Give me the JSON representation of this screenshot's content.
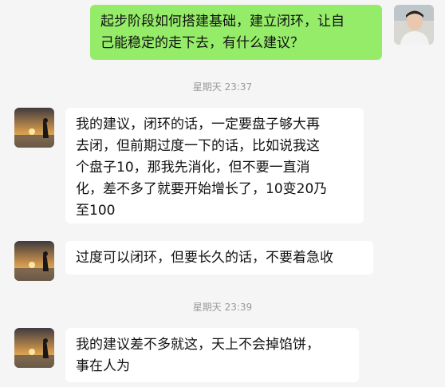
{
  "messages": [
    {
      "direction": "out",
      "lines": [
        "起步阶段如何搭建基础，建立闭环，让自",
        "己能稳定的走下去，有什么建议？"
      ]
    },
    {
      "type": "timestamp",
      "text": "星期天 23:37"
    },
    {
      "direction": "in",
      "lines": [
        "我的建议，闭环的话，一定要盘子够大再",
        "去闭，但前期过度一下的话，比如说我这",
        "个盘子10，那我先消化，但不要一直消",
        "化，差不多了就要开始增长了，10变20乃",
        "至100"
      ]
    },
    {
      "direction": "in",
      "lines": [
        "过度可以闭环，但要长久的话，不要着急收"
      ]
    },
    {
      "type": "timestamp",
      "text": "星期天 23:39"
    },
    {
      "direction": "in",
      "lines": [
        "我的建议差不多就这，天上不会掉馅饼，",
        "事在人为"
      ]
    }
  ],
  "colors": {
    "background": "#f5f5f5",
    "outgoing_bubble": "#95ec69",
    "incoming_bubble": "#ffffff",
    "timestamp_text": "#9a9a9a"
  }
}
